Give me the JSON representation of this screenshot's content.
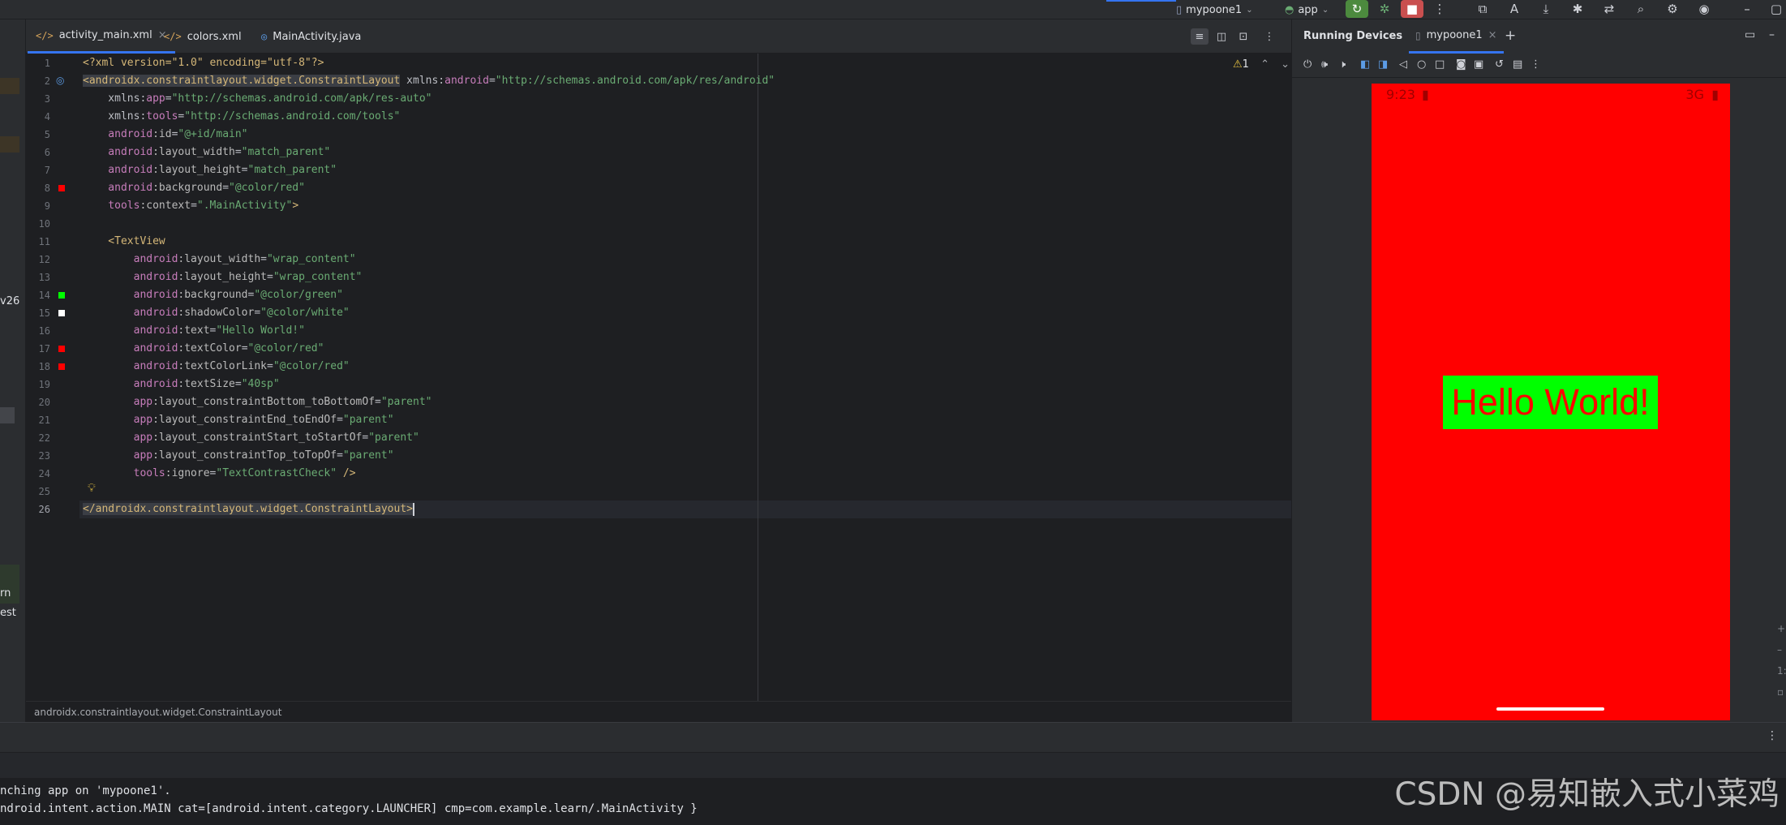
{
  "toolbar": {
    "device_name": "mypoone1",
    "run_config": "app"
  },
  "editor": {
    "tabs": [
      {
        "label": "activity_main.xml",
        "active": true
      },
      {
        "label": "colors.xml",
        "active": false
      },
      {
        "label": "MainActivity.java",
        "active": false
      }
    ],
    "inspection_count": "1",
    "breadcrumb": "androidx.constraintlayout.widget.ConstraintLayout"
  },
  "code_lines": [
    [
      "1",
      [
        [
          "pi",
          "<?xml version=\"1.0\" encoding=\"utf-8\"?>"
        ]
      ]
    ],
    [
      "2",
      [
        [
          "tag-hl",
          "<androidx.constraintlayout.widget.ConstraintLayout"
        ],
        [
          "plain",
          " xmlns:"
        ],
        [
          "ns",
          "android"
        ],
        [
          "plain",
          "="
        ],
        [
          "str",
          "\"http://schemas.android.com/apk/res/android\""
        ]
      ]
    ],
    [
      "3",
      [
        [
          "plain",
          "    xmlns:"
        ],
        [
          "ns",
          "app"
        ],
        [
          "plain",
          "="
        ],
        [
          "str",
          "\"http://schemas.android.com/apk/res-auto\""
        ]
      ]
    ],
    [
      "4",
      [
        [
          "plain",
          "    xmlns:"
        ],
        [
          "ns",
          "tools"
        ],
        [
          "plain",
          "="
        ],
        [
          "str",
          "\"http://schemas.android.com/tools\""
        ]
      ]
    ],
    [
      "5",
      [
        [
          "ns",
          "    android"
        ],
        [
          "attr",
          ":id"
        ],
        [
          "plain",
          "="
        ],
        [
          "str",
          "\"@+id/main\""
        ]
      ]
    ],
    [
      "6",
      [
        [
          "ns",
          "    android"
        ],
        [
          "attr",
          ":layout_width"
        ],
        [
          "plain",
          "="
        ],
        [
          "str",
          "\"match_parent\""
        ]
      ]
    ],
    [
      "7",
      [
        [
          "ns",
          "    android"
        ],
        [
          "attr",
          ":layout_height"
        ],
        [
          "plain",
          "="
        ],
        [
          "str",
          "\"match_parent\""
        ]
      ]
    ],
    [
      "8",
      [
        [
          "ns",
          "    android"
        ],
        [
          "attr",
          ":background"
        ],
        [
          "plain",
          "="
        ],
        [
          "str",
          "\"@color/red\""
        ]
      ]
    ],
    [
      "9",
      [
        [
          "ns",
          "    tools"
        ],
        [
          "attr",
          ":context"
        ],
        [
          "plain",
          "="
        ],
        [
          "str",
          "\".MainActivity\""
        ],
        [
          "tag",
          ">"
        ]
      ]
    ],
    [
      "10",
      []
    ],
    [
      "11",
      [
        [
          "tag",
          "    <TextView"
        ]
      ]
    ],
    [
      "12",
      [
        [
          "ns",
          "        android"
        ],
        [
          "attr",
          ":layout_width"
        ],
        [
          "plain",
          "="
        ],
        [
          "str",
          "\"wrap_content\""
        ]
      ]
    ],
    [
      "13",
      [
        [
          "ns",
          "        android"
        ],
        [
          "attr",
          ":layout_height"
        ],
        [
          "plain",
          "="
        ],
        [
          "str",
          "\"wrap_content\""
        ]
      ]
    ],
    [
      "14",
      [
        [
          "ns",
          "        android"
        ],
        [
          "attr",
          ":background"
        ],
        [
          "plain",
          "="
        ],
        [
          "str",
          "\"@color/green\""
        ]
      ]
    ],
    [
      "15",
      [
        [
          "ns",
          "        android"
        ],
        [
          "attr",
          ":shadowColor"
        ],
        [
          "plain",
          "="
        ],
        [
          "str",
          "\"@color/white\""
        ]
      ]
    ],
    [
      "16",
      [
        [
          "ns",
          "        android"
        ],
        [
          "attr",
          ":text"
        ],
        [
          "plain",
          "="
        ],
        [
          "str",
          "\"Hello World!\""
        ]
      ]
    ],
    [
      "17",
      [
        [
          "ns",
          "        android"
        ],
        [
          "attr",
          ":textColor"
        ],
        [
          "plain",
          "="
        ],
        [
          "str",
          "\"@color/red\""
        ]
      ]
    ],
    [
      "18",
      [
        [
          "ns",
          "        android"
        ],
        [
          "attr",
          ":textColorLink"
        ],
        [
          "plain",
          "="
        ],
        [
          "str",
          "\"@color/red\""
        ]
      ]
    ],
    [
      "19",
      [
        [
          "ns",
          "        android"
        ],
        [
          "attr",
          ":textSize"
        ],
        [
          "plain",
          "="
        ],
        [
          "str",
          "\"40sp\""
        ]
      ]
    ],
    [
      "20",
      [
        [
          "ns",
          "        app"
        ],
        [
          "attr",
          ":layout_constraintBottom_toBottomOf"
        ],
        [
          "plain",
          "="
        ],
        [
          "str",
          "\"parent\""
        ]
      ]
    ],
    [
      "21",
      [
        [
          "ns",
          "        app"
        ],
        [
          "attr",
          ":layout_constraintEnd_toEndOf"
        ],
        [
          "plain",
          "="
        ],
        [
          "str",
          "\"parent\""
        ]
      ]
    ],
    [
      "22",
      [
        [
          "ns",
          "        app"
        ],
        [
          "attr",
          ":layout_constraintStart_toStartOf"
        ],
        [
          "plain",
          "="
        ],
        [
          "str",
          "\"parent\""
        ]
      ]
    ],
    [
      "23",
      [
        [
          "ns",
          "        app"
        ],
        [
          "attr",
          ":layout_constraintTop_toTopOf"
        ],
        [
          "plain",
          "="
        ],
        [
          "str",
          "\"parent\""
        ]
      ]
    ],
    [
      "24",
      [
        [
          "ns",
          "        tools"
        ],
        [
          "attr",
          ":ignore"
        ],
        [
          "plain",
          "="
        ],
        [
          "str",
          "\"TextContrastCheck\""
        ],
        [
          "tag",
          " />"
        ]
      ]
    ],
    [
      "25",
      []
    ],
    [
      "26",
      [
        [
          "tag-hl",
          "</androidx.constraintlayout.widget.ConstraintLayout>"
        ]
      ]
    ]
  ],
  "gutter_swatches": [
    {
      "line": 8,
      "color": "#ff0000"
    },
    {
      "line": 14,
      "color": "#00ff00"
    },
    {
      "line": 15,
      "color": "#ffffff"
    },
    {
      "line": 17,
      "color": "#ff0000"
    },
    {
      "line": 18,
      "color": "#ff0000"
    }
  ],
  "left_strip": {
    "partial_1": "v26",
    "partial_2": "rn",
    "partial_3": "est"
  },
  "running_devices": {
    "title": "Running Devices",
    "tab": "mypoone1",
    "status_time": "9:23",
    "status_right": "3G",
    "screen_color": "#ff0000",
    "app_text": "Hello World!",
    "text_bg": "#00ff00",
    "text_color": "#ff0000"
  },
  "console": {
    "line1": "nching app on 'mypoone1'.",
    "line2": "ndroid.intent.action.MAIN cat=[android.intent.category.LAUNCHER] cmp=com.example.learn/.MainActivity }"
  },
  "watermark": "CSDN @易知嵌入式小菜鸡",
  "colors": {
    "accent": "#3574f0",
    "editor_bg": "#1e1f22",
    "panel_bg": "#2b2d30"
  }
}
